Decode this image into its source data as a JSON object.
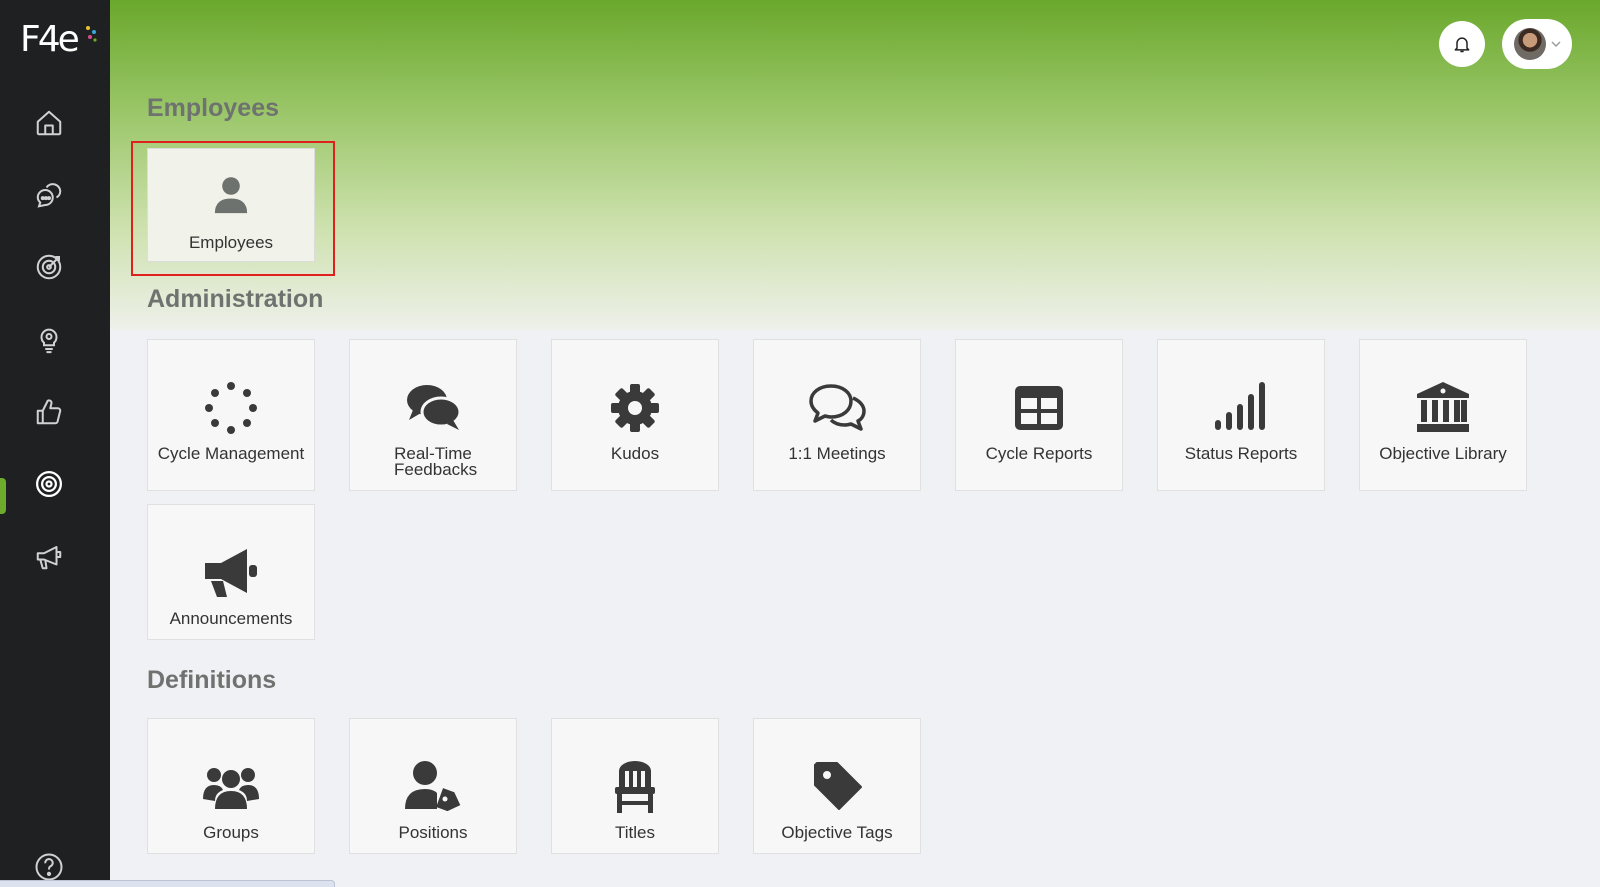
{
  "app": {
    "logo_text": "F4e",
    "accent_color": "#6eaa2c",
    "highlight_color": "#e0201d"
  },
  "sidebar": {
    "items": [
      {
        "name": "home-icon"
      },
      {
        "name": "chat-icon"
      },
      {
        "name": "target-icon"
      },
      {
        "name": "lightbulb-icon"
      },
      {
        "name": "thumbs-up-icon"
      },
      {
        "name": "settings-icon",
        "active": true
      },
      {
        "name": "megaphone-icon"
      }
    ],
    "help_icon": "question-icon"
  },
  "header": {
    "bell_icon": "bell-icon",
    "avatar_icon": "avatar"
  },
  "sections": {
    "employees": {
      "title": "Employees",
      "tiles": [
        {
          "label": "Employees",
          "icon": "user-icon"
        }
      ]
    },
    "administration": {
      "title": "Administration",
      "tiles": [
        {
          "label": "Cycle Management",
          "icon": "spinner-icon"
        },
        {
          "label": "Real-Time Feedbacks",
          "icon": "comments-icon"
        },
        {
          "label": "Kudos",
          "icon": "gear-icon"
        },
        {
          "label": "1:1 Meetings",
          "icon": "comments-outline-icon"
        },
        {
          "label": "Cycle Reports",
          "icon": "table-icon"
        },
        {
          "label": "Status Reports",
          "icon": "signal-icon"
        },
        {
          "label": "Objective Library",
          "icon": "bank-icon"
        },
        {
          "label": "Announcements",
          "icon": "bullhorn-icon"
        }
      ]
    },
    "definitions": {
      "title": "Definitions",
      "tiles": [
        {
          "label": "Groups",
          "icon": "users-icon"
        },
        {
          "label": "Positions",
          "icon": "user-tag-icon"
        },
        {
          "label": "Titles",
          "icon": "chair-icon"
        },
        {
          "label": "Objective Tags",
          "icon": "tag-icon"
        }
      ]
    }
  }
}
